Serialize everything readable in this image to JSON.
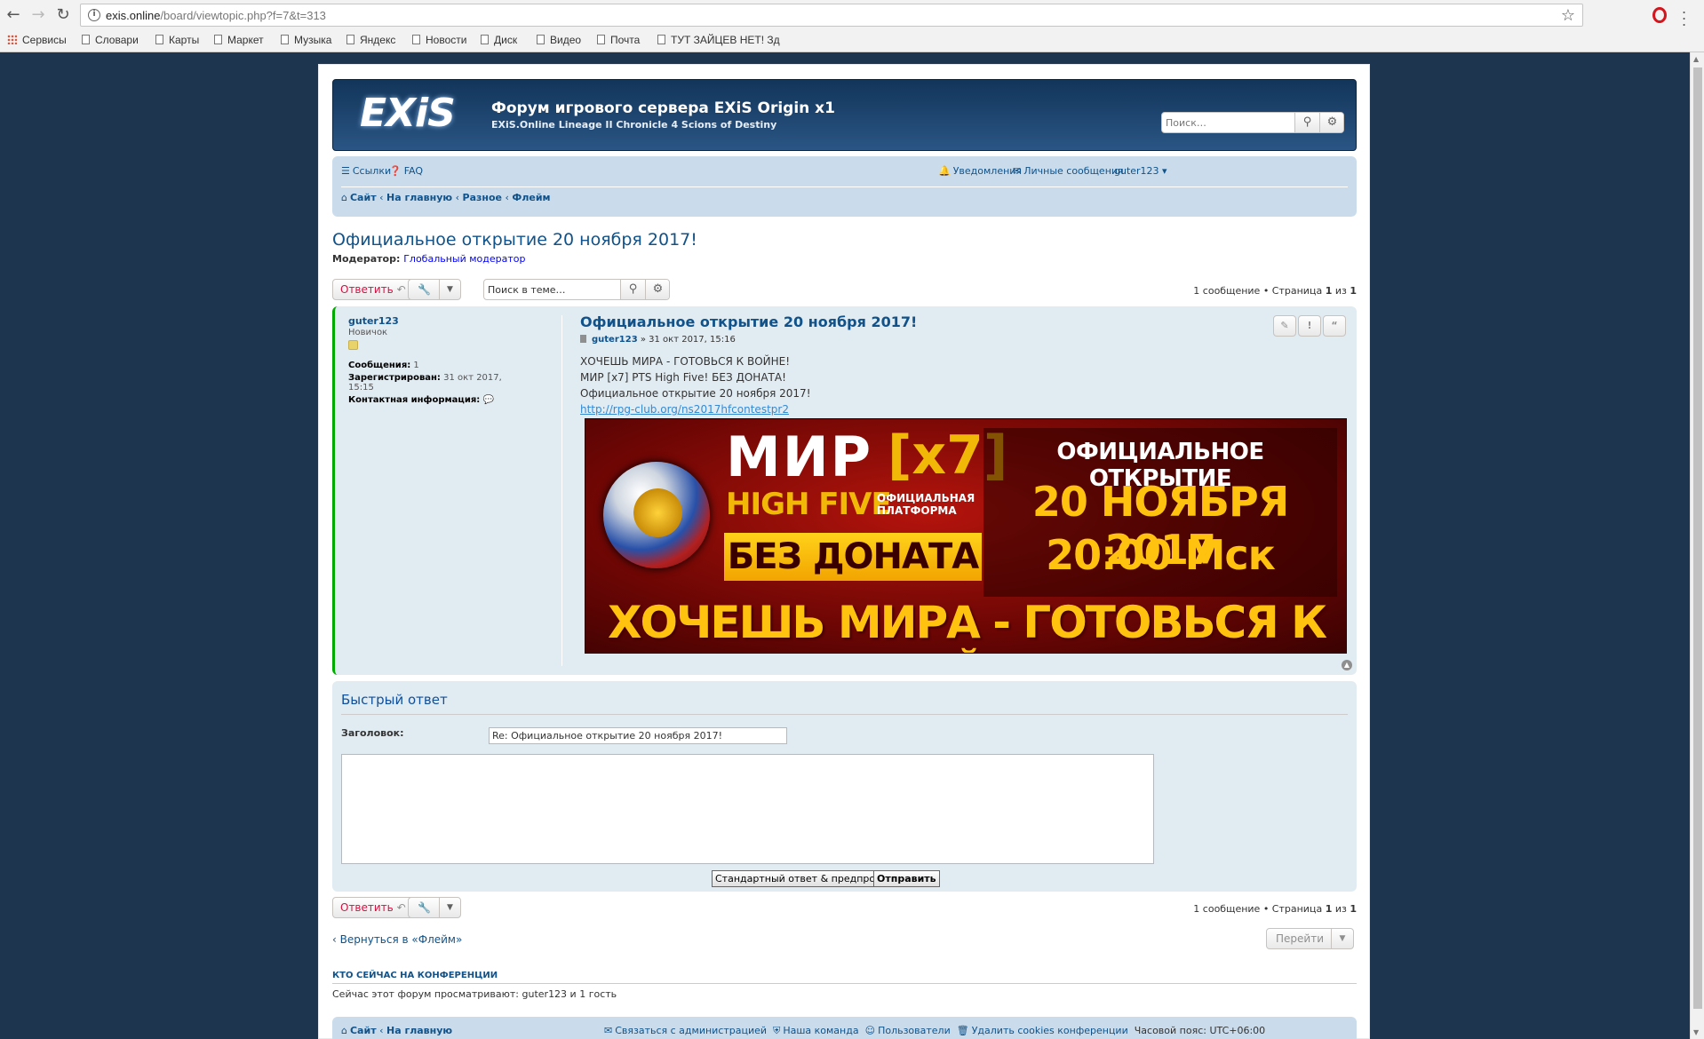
{
  "browser": {
    "url_host": "exis.online",
    "url_path": "/board/viewtopic.php?f=7&t=313",
    "bookmarks": [
      "Сервисы",
      "Словари",
      "Карты",
      "Маркет",
      "Музыка",
      "Яндекс",
      "Новости",
      "Диск",
      "Видео",
      "Почта",
      "ТУТ ЗАЙЦЕВ НЕТ! Зд"
    ]
  },
  "header": {
    "logo_text": "EXiS",
    "site_title": "Форум игрового сервера EXiS Origin x1",
    "site_desc": "EXiS.Online Lineage II Chronicle 4 Scions of Destiny",
    "search_placeholder": "Поиск…"
  },
  "navbar": {
    "links": "Ссылки",
    "faq": "FAQ",
    "notifications": "Уведомления",
    "messages": "Личные сообщения",
    "user": "guter123",
    "breadcrumbs": [
      "Сайт",
      "На главную",
      "Разное",
      "Флейм"
    ]
  },
  "topic": {
    "title": "Официальное открытие 20 ноября 2017!",
    "moderator_label": "Модератор:",
    "moderator": "Глобальный модератор",
    "reply_label": "Ответить",
    "search_placeholder": "Поиск в теме…",
    "pageinfo_prefix": "1 сообщение • Страница ",
    "page_current": "1",
    "page_of": " из ",
    "page_total": "1"
  },
  "post": {
    "author": "guter123",
    "rank": "Новичок",
    "posts_label": "Сообщения:",
    "posts": "1",
    "registered_label": "Зарегистрирован:",
    "registered": "31 окт 2017, 15:15",
    "contact_label": "Контактная информация:",
    "title": "Официальное открытие 20 ноября 2017!",
    "meta_author": "guter123",
    "meta_date": "» 31 окт 2017, 15:16",
    "lines": [
      "ХОЧЕШЬ МИРА - ГОТОВЬСЯ К ВОЙНЕ!",
      "МИР [x7] PTS High Five! БЕЗ ДОНАТА!",
      "Официальное открытие 20 ноября 2017!"
    ],
    "link": "http://rpg-club.org/ns2017hfcontestpr2"
  },
  "banner": {
    "mir": "МИР",
    "x7": "[x7]",
    "high_five": "HIGH FIVE",
    "platform": "ОФИЦИАЛЬНАЯ ПЛАТФОРМА",
    "no_donate": "БЕЗ ДОНАТА",
    "official_open": "ОФИЦИАЛЬНОЕ ОТКРЫТИЕ",
    "date": "20 НОЯБРЯ 2017",
    "time": "20:00 Мск",
    "slogan": "ХОЧЕШЬ МИРА - ГОТОВЬСЯ К ВОЙНЕ"
  },
  "quick_reply": {
    "title": "Быстрый ответ",
    "subject_label": "Заголовок:",
    "subject_value": "Re: Официальное открытие 20 ноября 2017!",
    "preview_button": "Стандартный ответ & предпросмотр",
    "submit_button": "Отправить"
  },
  "bottom": {
    "back_link": "Вернуться в «Флейм»",
    "jump": "Перейти",
    "online_heading": "КТО СЕЙЧАС НА КОНФЕРЕНЦИИ",
    "online_text": "Сейчас этот форум просматривают: guter123 и 1 гость"
  },
  "footer": {
    "site": "Сайт",
    "home": "На главную",
    "contact": "Связаться с администрацией",
    "team": "Наша команда",
    "users": "Пользователи",
    "cookies": "Удалить cookies конференции",
    "timezone": "Часовой пояс: UTC+06:00"
  }
}
